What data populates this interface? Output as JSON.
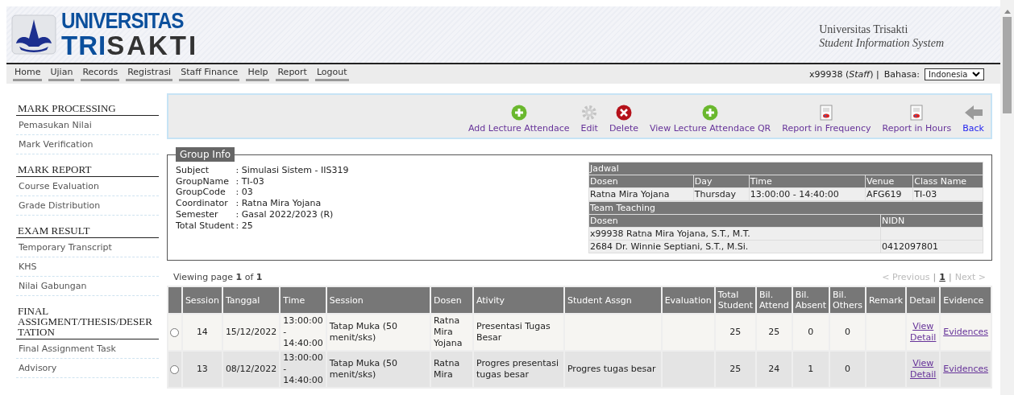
{
  "header": {
    "logo_top": "UNIVERSITAS",
    "logo_bottom": [
      "TRI",
      "SAKTI"
    ],
    "title": "Universitas Trisakti",
    "subtitle": "Student Information System"
  },
  "menu": [
    {
      "label": "Home"
    },
    {
      "label": "Ujian"
    },
    {
      "label": "Records"
    },
    {
      "label": "Registrasi"
    },
    {
      "label": "Staff Finance"
    },
    {
      "label": "Help"
    },
    {
      "label": "Report"
    },
    {
      "label": "Logout"
    }
  ],
  "user": {
    "text": "x99938 (*Staff*) |",
    "language_label": "Bahasa:",
    "language": "Indonesia"
  },
  "sidebar": [
    {
      "title": "MARK PROCESSING",
      "items": [
        "Pemasukan Nilai",
        "Mark Verification"
      ]
    },
    {
      "title": "MARK REPORT",
      "items": [
        "Course Evaluation",
        "Grade Distribution"
      ]
    },
    {
      "title": "EXAM RESULT",
      "items": [
        "Temporary Transcript",
        "KHS",
        "Nilai Gabungan"
      ]
    },
    {
      "title": "FINAL ASSIGMENT/THESIS/DESERTATION",
      "items": [
        "Final Assignment Task",
        "Advisory"
      ]
    }
  ],
  "toolbar": [
    {
      "label": "Add Lecture Attendace",
      "kind": "add"
    },
    {
      "label": "Edit",
      "kind": "gear"
    },
    {
      "label": "Delete",
      "kind": "delete"
    },
    {
      "label": "View Lecture Attendace QR",
      "kind": "add"
    },
    {
      "label": "Report in Frequency",
      "kind": "report"
    },
    {
      "label": "Report in Hours",
      "kind": "report"
    },
    {
      "label": "Back",
      "kind": "back"
    }
  ],
  "group_info": {
    "legend": "Group Info",
    "fields": [
      {
        "label": "Subject",
        "value": ": Simulasi Sistem - IIS319"
      },
      {
        "label": "GroupName",
        "value": ": TI-03"
      },
      {
        "label": "GroupCode",
        "value": ": 03"
      },
      {
        "label": "Coordinator",
        "value": ": Ratna Mira Yojana"
      },
      {
        "label": "Semester",
        "value": ": Gasal 2022/2023 (R)"
      },
      {
        "label": "Total Student",
        "value": ": 25"
      }
    ],
    "schedule": {
      "title": "Jadwal",
      "columns": [
        "Dosen",
        "Day",
        "Time",
        "Venue",
        "Class Name"
      ],
      "rows": [
        [
          "Ratna Mira Yojana",
          "Thursday",
          "13:00:00 - 14:40:00",
          "AFG619",
          "TI-03"
        ]
      ]
    },
    "team": {
      "title": "Team Teaching",
      "columns": [
        "Dosen",
        "NIDN"
      ],
      "rows": [
        [
          "x99938 Ratna Mira Yojana, S.T., M.T."
        ],
        [
          "2684 Dr. Winnie Septiani, S.T., M.Si.",
          "0412097801"
        ]
      ]
    }
  },
  "viewing": "Viewing page **1** of **1**",
  "pagination": {
    "previous": {
      "label": "< Previous",
      "disabled": true
    },
    "separator": "|",
    "pages": [
      {
        "label": "1",
        "selected": true
      }
    ],
    "next": {
      "label": "Next >",
      "disabled": true
    }
  },
  "table": {
    "columns": [
      {
        "label": "Session",
        "kind": "number"
      },
      {
        "label": "Tanggal",
        "kind": "text"
      },
      {
        "label": "Time",
        "kind": "text"
      },
      {
        "label": "Session",
        "kind": "text"
      },
      {
        "label": "Dosen",
        "kind": "text"
      },
      {
        "label": "Ativity",
        "kind": "text"
      },
      {
        "label": "Student Assgn",
        "kind": "text"
      },
      {
        "label": "Evaluation"
      },
      {
        "label": "Total Student",
        "kind": "number"
      },
      {
        "label": "Bil. Attend",
        "kind": "number"
      },
      {
        "label": "Bil. Absent",
        "kind": "number"
      },
      {
        "label": "Bil. Others",
        "kind": "number"
      },
      {
        "label": "Remark"
      },
      {
        "label": "Detail",
        "kind": "link"
      },
      {
        "label": "Evidence",
        "kind": "link"
      }
    ],
    "rows": [
      {
        "selected": false,
        "cells": [
          "14",
          "15/12/2022",
          "13:00:00 - 14:40:00",
          "Tatap Muka (50 menit/sks)",
          "Ratna Mira Yojana",
          "Presentasi Tugas Besar",
          null,
          null,
          "25",
          "25",
          "0",
          "0",
          null,
          "View Detail",
          "Evidences"
        ]
      },
      {
        "selected": false,
        "cells": [
          "13",
          "08/12/2022",
          "13:00:00 - 14:40:00",
          "Tatap Muka (50 menit/sks)",
          "Ratna Mira",
          "Progres presentasi tugas besar",
          "Progres tugas besar",
          null,
          "25",
          "24",
          "1",
          "0",
          null,
          "View Detail",
          "Evidences"
        ]
      }
    ]
  }
}
